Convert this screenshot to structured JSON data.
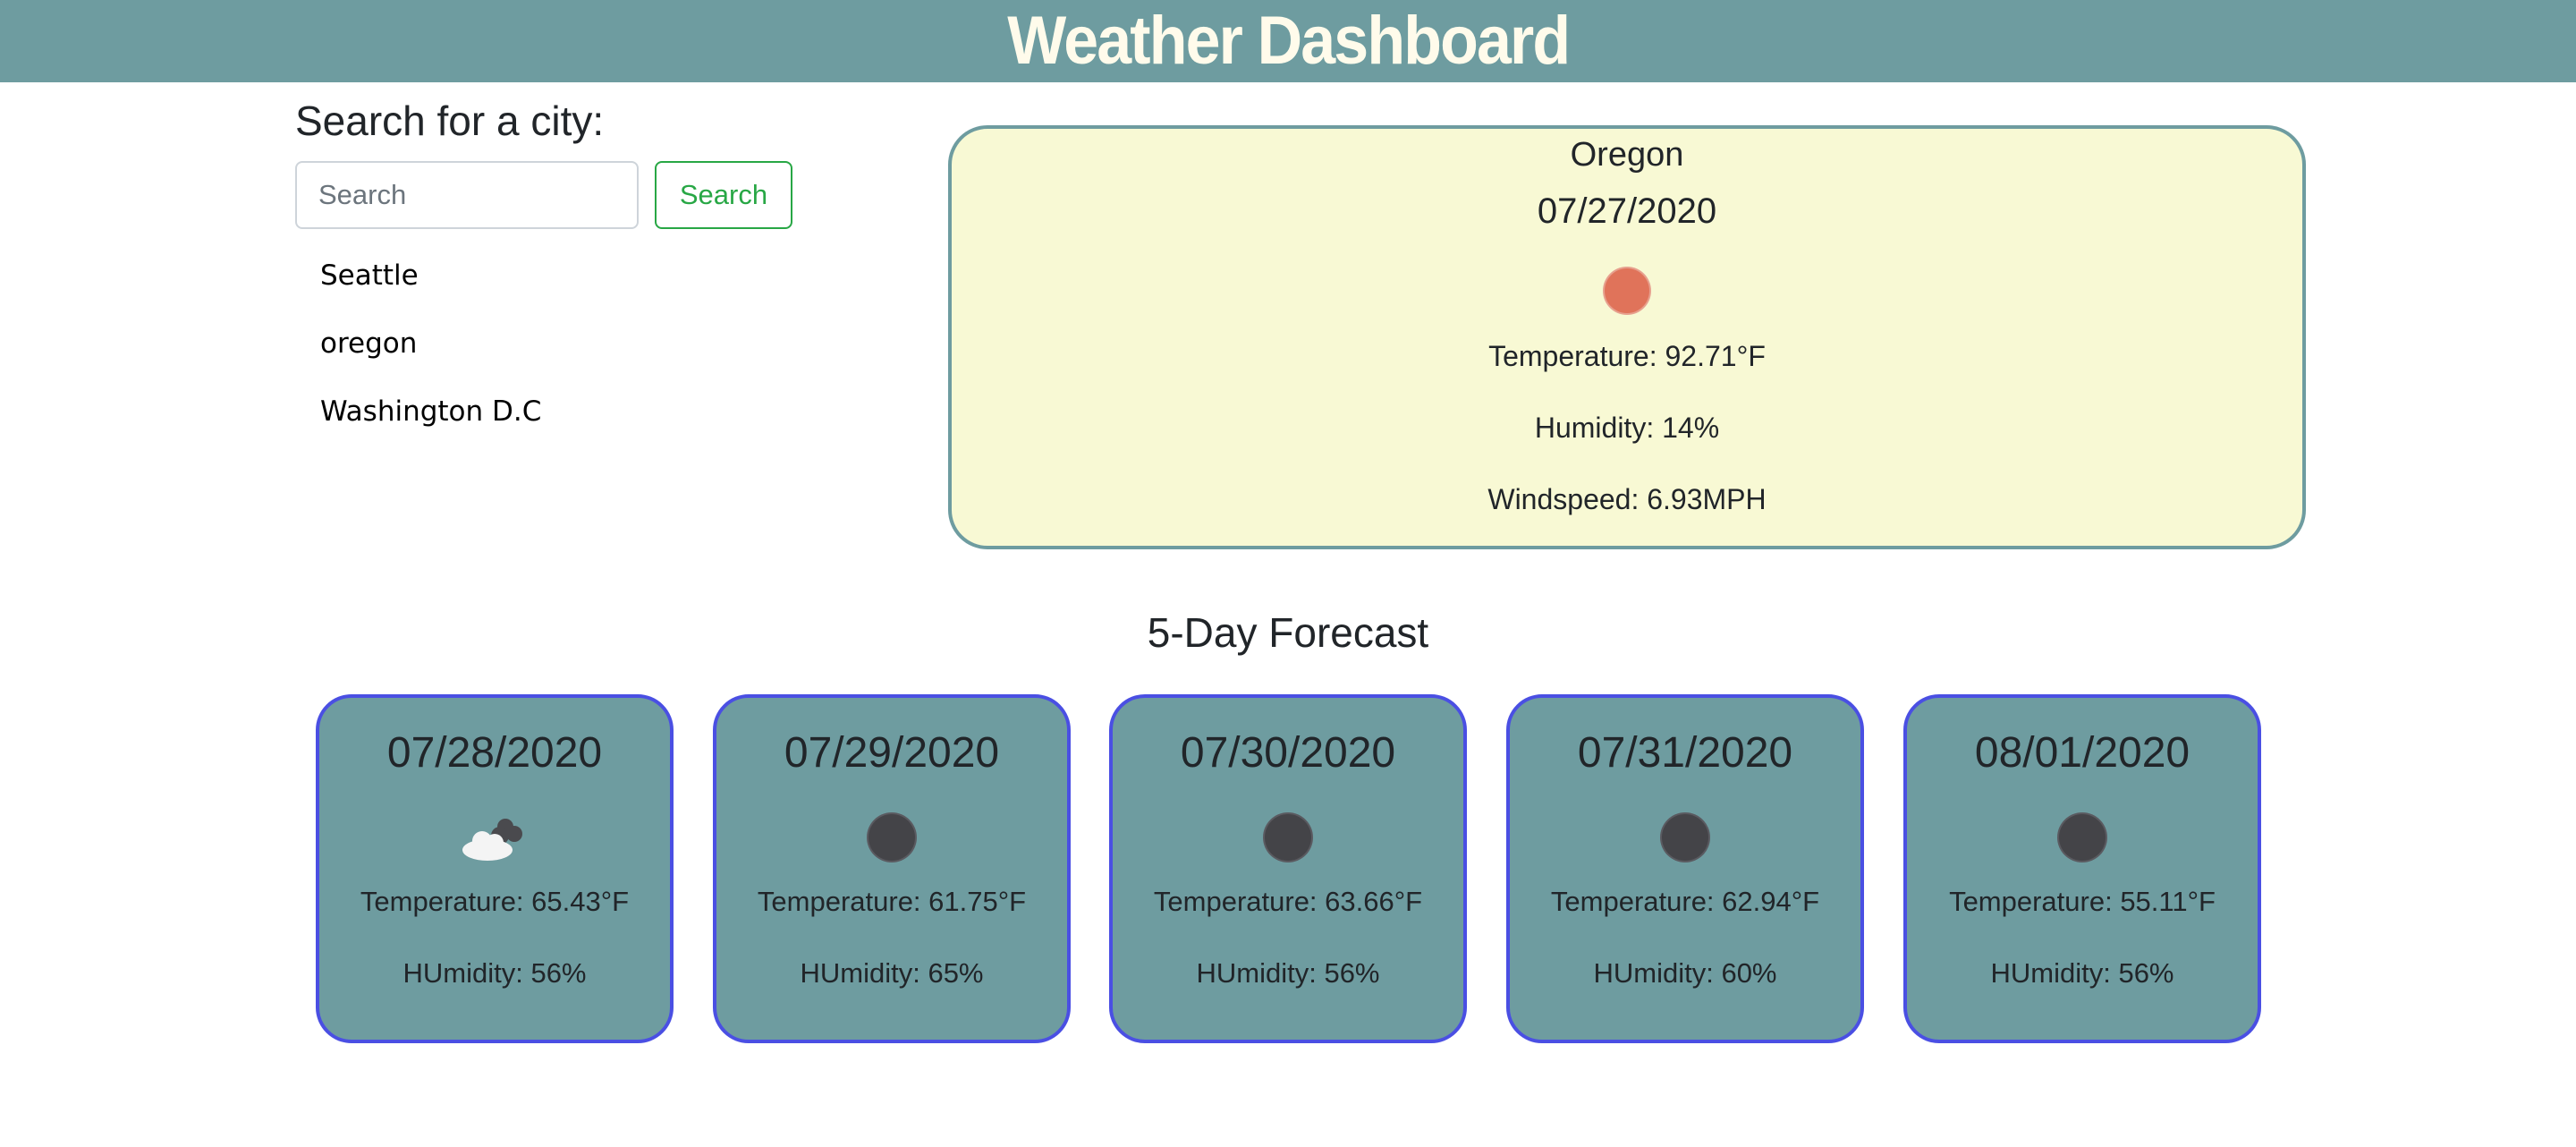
{
  "header": {
    "title": "Weather Dashboard"
  },
  "search": {
    "heading": "Search for a city:",
    "placeholder": "Search",
    "button_label": "Search",
    "history": [
      "Seattle",
      "oregon",
      "Washington D.C"
    ]
  },
  "current": {
    "city": "Oregon",
    "date": "07/27/2020",
    "icon": "sun-icon",
    "temperature": "Temperature: 92.71°F",
    "humidity": "Humidity: 14%",
    "windspeed": "Windspeed: 6.93MPH"
  },
  "forecast": {
    "title": "5-Day Forecast",
    "days": [
      {
        "date": "07/28/2020",
        "icon": "clouds-icon",
        "temperature": "Temperature: 65.43°F",
        "humidity": "HUmidity: 56%"
      },
      {
        "date": "07/29/2020",
        "icon": "moon-icon",
        "temperature": "Temperature: 61.75°F",
        "humidity": "HUmidity: 65%"
      },
      {
        "date": "07/30/2020",
        "icon": "moon-icon",
        "temperature": "Temperature: 63.66°F",
        "humidity": "HUmidity: 56%"
      },
      {
        "date": "07/31/2020",
        "icon": "moon-icon",
        "temperature": "Temperature: 62.94°F",
        "humidity": "HUmidity: 60%"
      },
      {
        "date": "08/01/2020",
        "icon": "moon-icon",
        "temperature": "Temperature: 55.11°F",
        "humidity": "HUmidity: 56%"
      }
    ]
  },
  "colors": {
    "header_bg": "#6e9ca0",
    "current_card_bg": "#f8f9d4",
    "forecast_card_bg": "#6e9ca0",
    "forecast_card_border": "#4a4fe3",
    "search_button": "#28a745"
  }
}
